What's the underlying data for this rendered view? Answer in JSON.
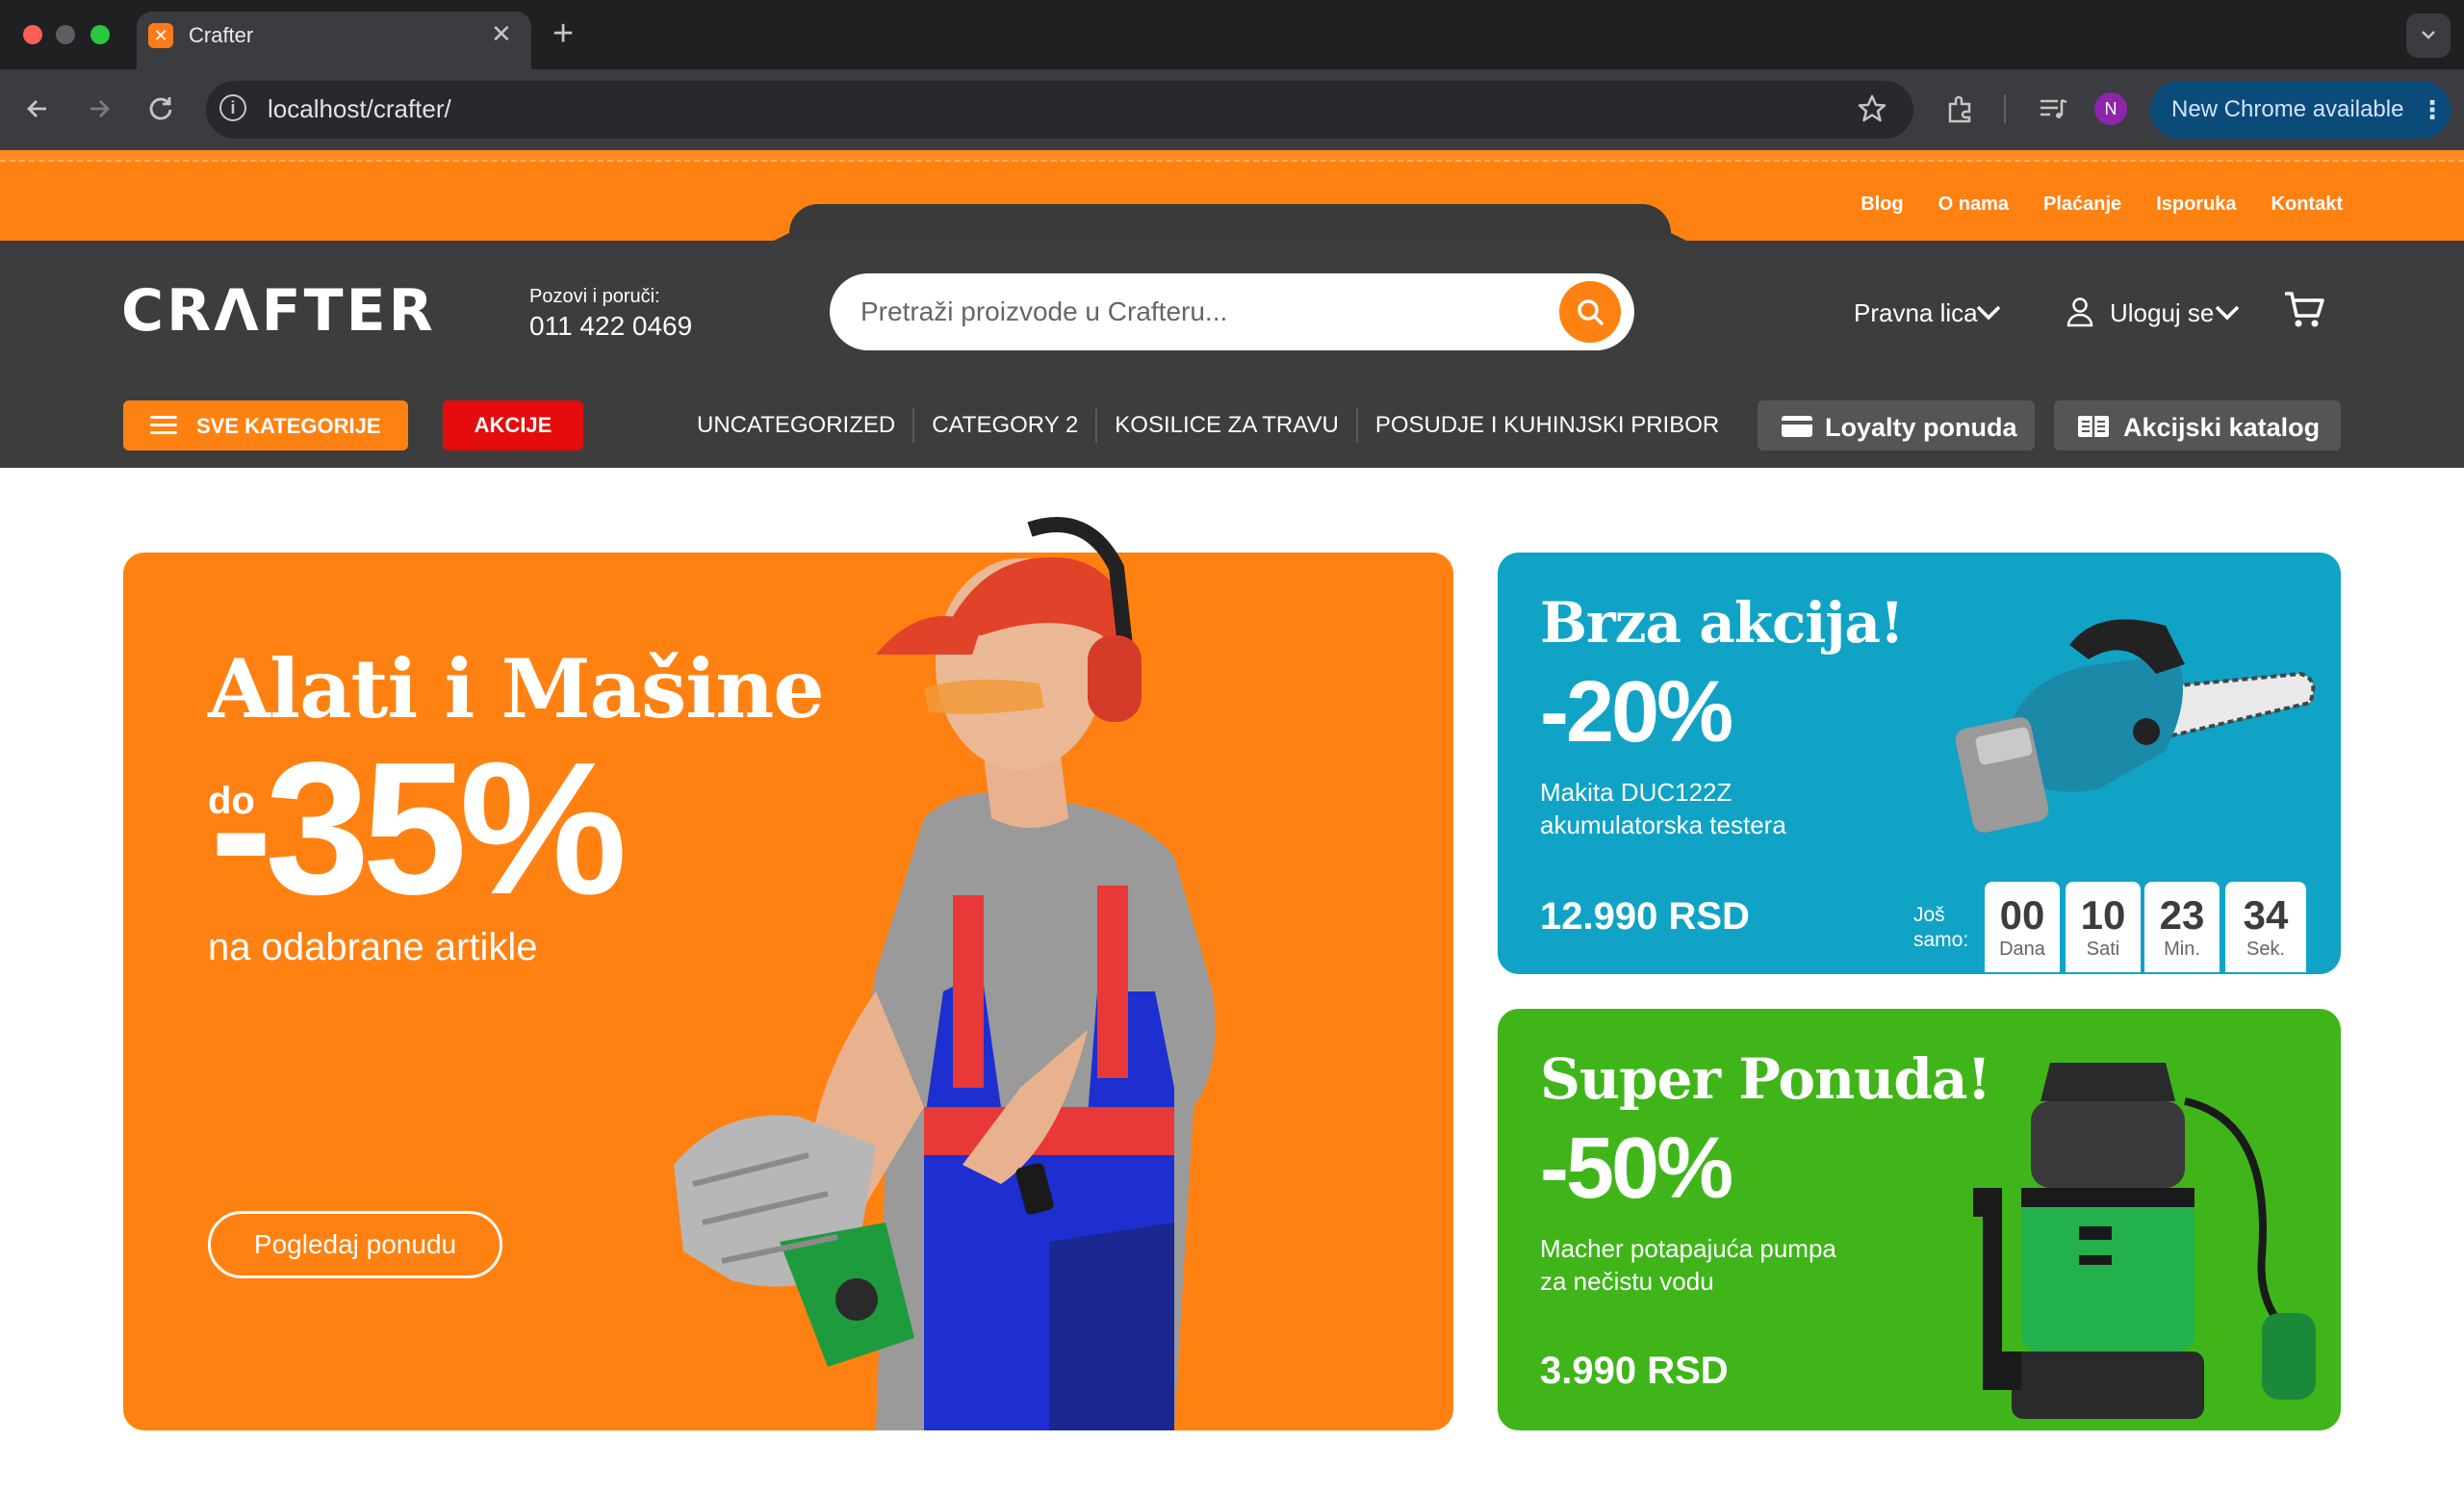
{
  "browser": {
    "tab_title": "Crafter",
    "url": "localhost/crafter/",
    "profile_initial": "N",
    "update_label": "New Chrome available"
  },
  "top_links": [
    "Blog",
    "O nama",
    "Plaćanje",
    "Isporuka",
    "Kontakt"
  ],
  "header": {
    "logo": "CRΛFTER",
    "call_label": "Pozovi i poruči:",
    "phone": "011 422 0469",
    "search_placeholder": "Pretraži proizvode u Crafteru...",
    "legal_label": "Pravna lica",
    "login_label": "Uloguj se"
  },
  "nav": {
    "all_categories": "SVE KATEGORIJE",
    "sales": "AKCIJE",
    "categories": [
      "UNCATEGORIZED",
      "CATEGORY 2",
      "KOSILICE ZA TRAVU",
      "POSUDJE I KUHINJSKI PRIBOR"
    ],
    "loyalty": "Loyalty ponuda",
    "catalog": "Akcijski katalog"
  },
  "hero": {
    "title": "Alati i Mašine",
    "prefix": "do",
    "discount": "-35%",
    "subtitle": "na odabrane artikle",
    "cta": "Pogledaj ponudu"
  },
  "promo_flash": {
    "title": "Brza akcija!",
    "discount": "-20%",
    "product": "Makita DUC122Z akumulatorska testera",
    "price": "12.990 RSD",
    "countdown_label": "Još samo:",
    "countdown": [
      {
        "value": "00",
        "unit": "Dana"
      },
      {
        "value": "10",
        "unit": "Sati"
      },
      {
        "value": "23",
        "unit": "Min."
      },
      {
        "value": "34",
        "unit": "Sek."
      }
    ]
  },
  "promo_super": {
    "title": "Super Ponuda!",
    "discount": "-50%",
    "product": "Macher potapajuća pumpa za nečistu vodu",
    "price": "3.990 RSD"
  },
  "colors": {
    "brand_orange": "#ff8112",
    "header_dark": "#3d3d3d",
    "sale_red": "#e40c0c",
    "flash_blue": "#10a3c6",
    "super_green": "#3fb51a"
  }
}
